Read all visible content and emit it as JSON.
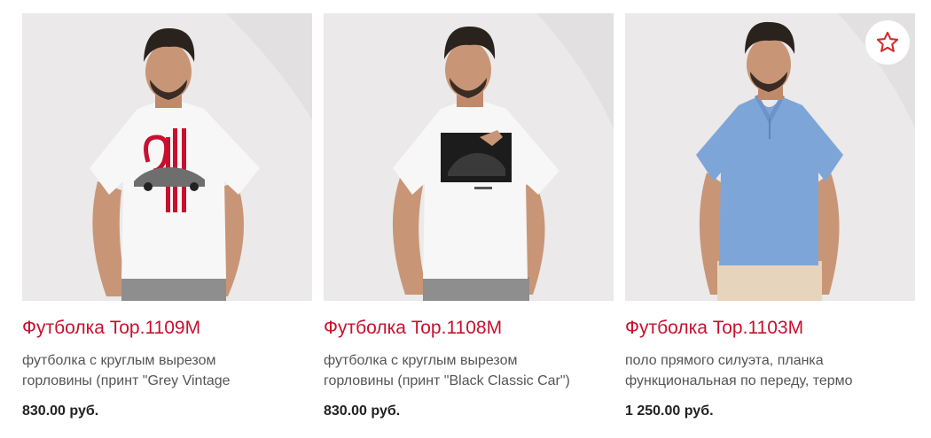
{
  "products": [
    {
      "title": "Футболка Top.1109M",
      "desc_line1": "футболка с круглым вырезом",
      "desc_line2": "горловины (принт \"Grey Vintage",
      "price": "830.00 руб.",
      "shirt_color": "#f7f7f7",
      "print": "911 car graphic"
    },
    {
      "title": "Футболка Top.1108M",
      "desc_line1": "футболка с круглым вырезом",
      "desc_line2": "горловины (принт \"Black Classic Car\")",
      "price": "830.00 руб.",
      "shirt_color": "#f7f7f7",
      "print": "black car photo"
    },
    {
      "title": "Футболка Top.1103M",
      "desc_line1": "поло прямого силуэта, планка",
      "desc_line2": "функциональная по переду, термо",
      "price": "1 250.00 руб.",
      "shirt_color": "#7ea5d8",
      "print": "none"
    }
  ],
  "favorite_icon": "star-outline-icon",
  "colors": {
    "title": "#c8102e",
    "desc": "#555555",
    "price": "#222222",
    "photo_bg": "#eceaea",
    "favorite": "#d32f2f"
  }
}
